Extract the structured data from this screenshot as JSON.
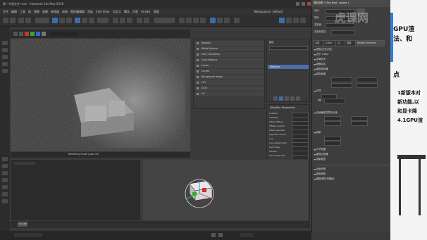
{
  "window": {
    "title": "第一节课文件.max - Autodesk 3ds Max 2018",
    "workspace": "Workspaces: Default"
  },
  "menu": {
    "items": [
      "文件",
      "编辑",
      "工具",
      "组",
      "视图",
      "创建",
      "修改器",
      "动画",
      "图形编辑器",
      "渲染",
      "Civil View",
      "自定义",
      "脚本",
      "内容",
      "Arnold",
      "帮助"
    ]
  },
  "render_window": {
    "status": "Rendering image (pass 30)"
  },
  "render_elements": {
    "items": [
      "Reprodu",
      "White Balance",
      "Hue / Saturation",
      "Color Balance",
      "Levels",
      "Curves",
      "Background Image",
      "LUT",
      "OCIO",
      "ICC"
    ]
  },
  "mid_panel": {
    "header": "图层",
    "selected_item": "VRayDen"
  },
  "params": {
    "title": "VRayDen Parameters",
    "rows": [
      "enabled",
      "vistiality",
      "effect diffuse",
      "diffuse contrib",
      "effect specular",
      "specular contrib",
      "raw",
      "raw subsampled",
      "dark bugs",
      "texture",
      "secondary acts",
      "size multiplier",
      "filter color",
      "color mode",
      "shadow samples",
      "shadow bias",
      "photon emit",
      "dry mode",
      "indirect lays",
      "ground pred",
      "fixed angle",
      "horizon",
      "horizon offset"
    ]
  },
  "render_setup": {
    "title": "渲染设置: V-Ray Next, update 1",
    "target_label": "目标:",
    "preset_label": "预设:",
    "renderer_label": "渲染器:",
    "view_label": "查看到渲染:",
    "tabs": [
      "公用",
      "V-Ray",
      "GI",
      "设置",
      "Render Elements"
    ],
    "rollouts": [
      "授权[无名汉化]",
      "关于 V-Ray",
      "全局开关",
      "帧缓冲区",
      "图像采样器",
      "颜色贴图",
      "环境",
      "全局确定性蒙特卡洛",
      "相机",
      "光子贴图",
      "图像过滤器",
      "渲染遮罩"
    ],
    "bottom_rollouts": [
      "全局光照",
      "颜色映射",
      "图像采样(抗锯齿)"
    ]
  },
  "overlay": {
    "brand": "虎课网",
    "lines": [
      "GPU渲",
      "法、和",
      "点",
      "1新版本对",
      "新功能,以",
      "和显卡降",
      "4.1GPU渲"
    ]
  },
  "timeline": {
    "frame": "0 / 100"
  }
}
